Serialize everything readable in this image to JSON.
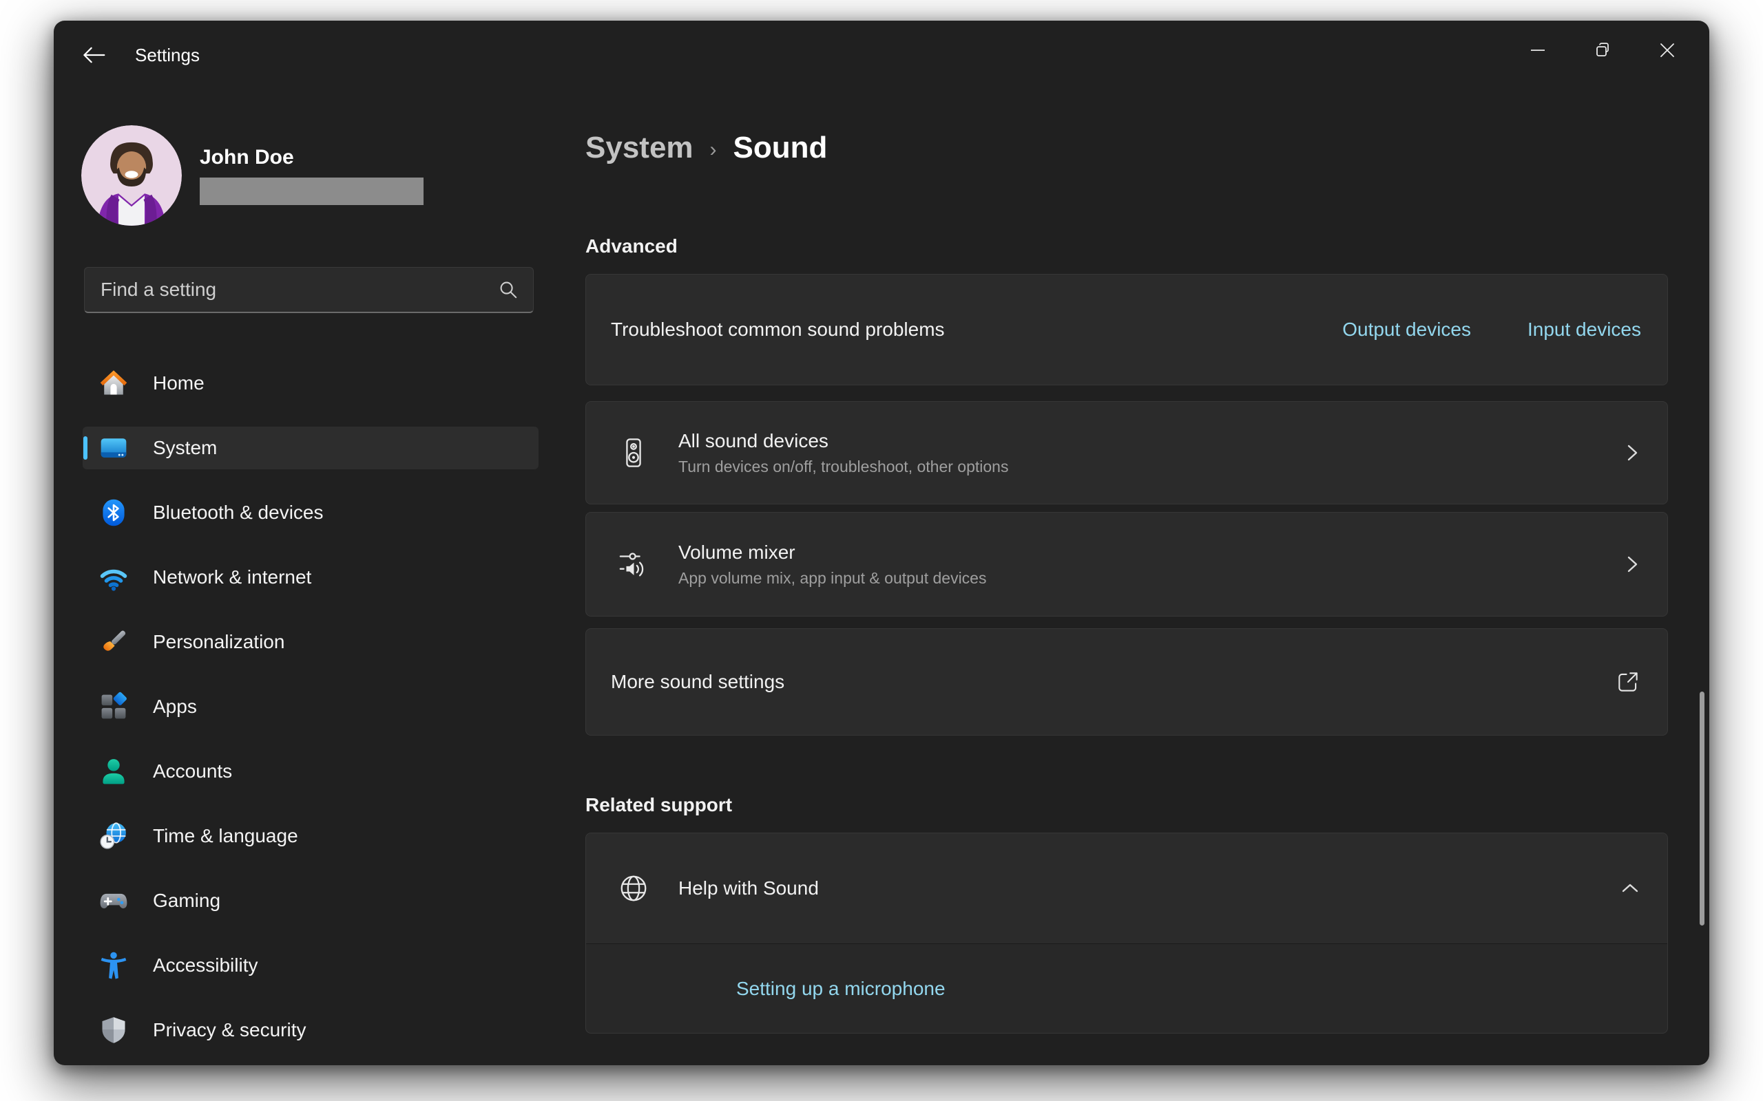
{
  "app": {
    "title": "Settings"
  },
  "user": {
    "name": "John Doe"
  },
  "search": {
    "placeholder": "Find a setting"
  },
  "sidebar": {
    "items": [
      {
        "label": "Home",
        "icon": "home-icon",
        "selected": false
      },
      {
        "label": "System",
        "icon": "system-icon",
        "selected": true
      },
      {
        "label": "Bluetooth & devices",
        "icon": "bluetooth-icon",
        "selected": false
      },
      {
        "label": "Network & internet",
        "icon": "network-icon",
        "selected": false
      },
      {
        "label": "Personalization",
        "icon": "personalization-icon",
        "selected": false
      },
      {
        "label": "Apps",
        "icon": "apps-icon",
        "selected": false
      },
      {
        "label": "Accounts",
        "icon": "accounts-icon",
        "selected": false
      },
      {
        "label": "Time & language",
        "icon": "time-language-icon",
        "selected": false
      },
      {
        "label": "Gaming",
        "icon": "gaming-icon",
        "selected": false
      },
      {
        "label": "Accessibility",
        "icon": "accessibility-icon",
        "selected": false
      },
      {
        "label": "Privacy & security",
        "icon": "shield-icon",
        "selected": false
      }
    ]
  },
  "breadcrumb": {
    "parent": "System",
    "separator": "›",
    "current": "Sound"
  },
  "advanced": {
    "heading": "Advanced",
    "troubleshoot": {
      "label": "Troubleshoot common sound problems",
      "output_link": "Output devices",
      "input_link": "Input devices"
    },
    "all_sound_devices": {
      "title": "All sound devices",
      "subtitle": "Turn devices on/off, troubleshoot, other options",
      "icon": "speaker-icon"
    },
    "volume_mixer": {
      "title": "Volume mixer",
      "subtitle": "App volume mix, app input & output devices",
      "icon": "mixer-icon"
    },
    "more_sound_settings": {
      "label": "More sound settings",
      "icon": "external-link-icon"
    }
  },
  "related_support": {
    "heading": "Related support",
    "help": {
      "title": "Help with Sound",
      "icon": "globe-icon",
      "expanded": true
    },
    "links": [
      {
        "label": "Setting up a microphone"
      }
    ]
  },
  "colors": {
    "accent": "#4CC2FF",
    "link_text": "#93D7EE",
    "window_bg": "#202020",
    "card_bg": "#2B2B2B"
  }
}
